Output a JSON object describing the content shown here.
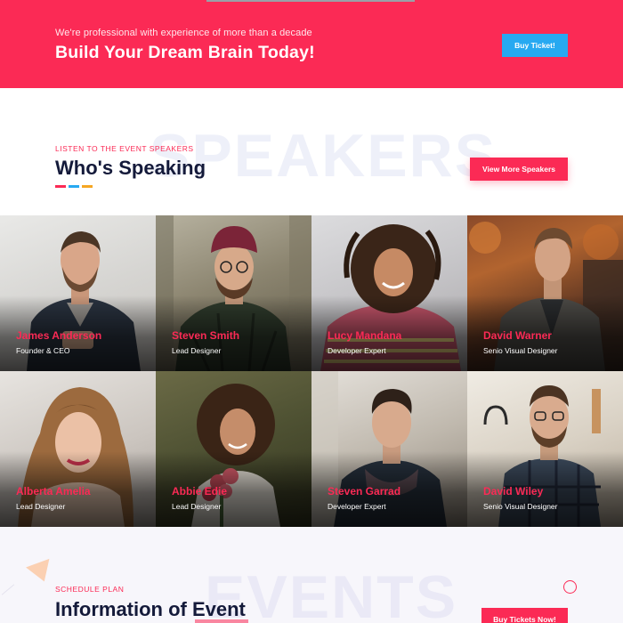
{
  "banner": {
    "tagline": "We're professional with experience of more than a decade",
    "title": "Build Your Dream Brain Today!",
    "button_label": "Buy Ticket!"
  },
  "speakers": {
    "watermark": "SPEAKERS",
    "eyebrow": "LISTEN TO THE EVENT SPEAKERS",
    "title": "Who's Speaking",
    "button_label": "View More Speakers",
    "dash_colors": [
      "#fb2a55",
      "#27a9f1",
      "#f5a623"
    ],
    "list": [
      {
        "name": "James Anderson",
        "role": "Founder & CEO"
      },
      {
        "name": "Steven Smith",
        "role": "Lead Designer"
      },
      {
        "name": "Lucy Mandana",
        "role": "Developer Expert"
      },
      {
        "name": "David Warner",
        "role": "Senio Visual Designer"
      },
      {
        "name": "Alberta Amelia",
        "role": "Lead Designer"
      },
      {
        "name": "Abbie Edie",
        "role": "Lead Designer"
      },
      {
        "name": "Steven Garrad",
        "role": "Developer Expert"
      },
      {
        "name": "David Wiley",
        "role": "Senio Visual Designer"
      }
    ]
  },
  "events": {
    "watermark": "EVENTS",
    "eyebrow": "SCHEDULE PLAN",
    "title": "Information of Event",
    "button_label": "Buy Tickets Now!"
  },
  "colors": {
    "accent": "#fb2a55",
    "blue": "#27a9f1",
    "navy": "#141a3a"
  }
}
